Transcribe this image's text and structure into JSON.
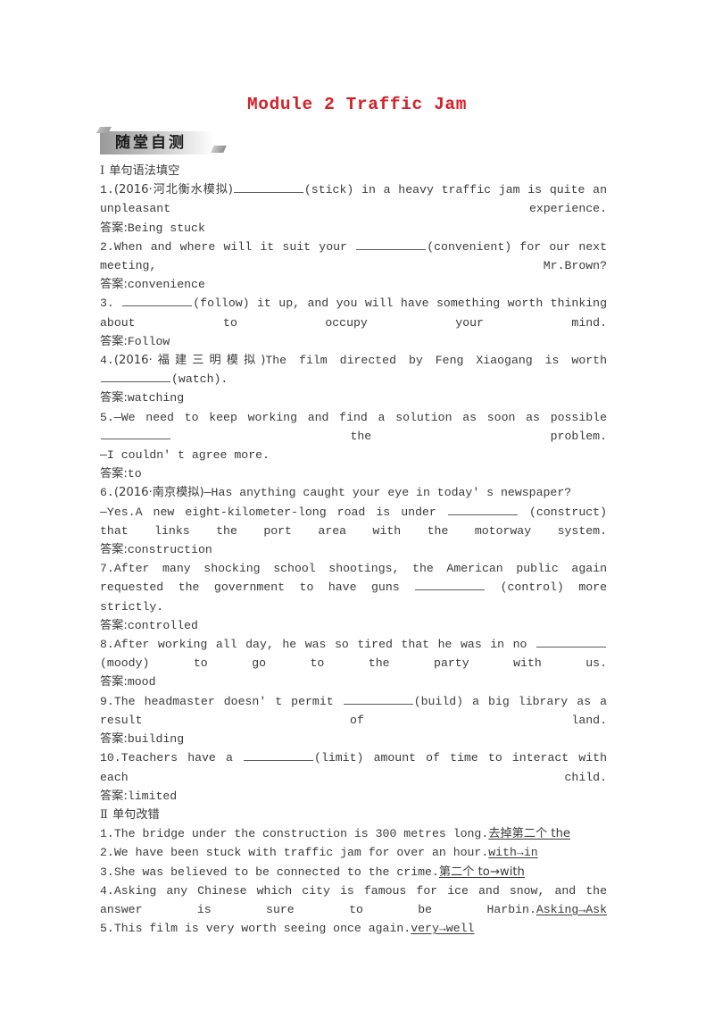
{
  "title": "Module 2 Traffic Jam",
  "accent_color": "#d81f26",
  "banner": {
    "label": "随堂自测"
  },
  "sections": [
    {
      "numeral": "Ⅰ",
      "heading": "单句语法填空",
      "answer_label": "答案:",
      "items": [
        {
          "number": "1.",
          "source": "(2016·河北衡水模拟)",
          "text_before": "",
          "cue": "(stick)",
          "text_after": " in a heavy traffic jam is quite an unpleasant experience.",
          "answer": "Being stuck"
        },
        {
          "number": "2.",
          "source": "",
          "text_before": "When and where will it suit your ",
          "cue": "(convenient)",
          "text_after": " for our next meeting, Mr.Brown?",
          "answer": "convenience"
        },
        {
          "number": "3.",
          "source": "",
          "text_before": " ",
          "cue": "(follow)",
          "text_after": " it up, and you will have something worth thinking about to occupy your mind.",
          "answer": "Follow"
        },
        {
          "number": "4.",
          "source": "(2016·福建三明模拟)",
          "text_before": "The film directed by Feng Xiaogang is worth ",
          "cue": "(watch).",
          "text_after": "",
          "answer": "watching"
        },
        {
          "number": "5.",
          "source": "",
          "text_before": "—We need to keep working and find a solution as soon as possible ",
          "cue": "",
          "text_after": " the problem.",
          "reply": "—I couldn' t agree more.",
          "answer": "to"
        },
        {
          "number": "6.",
          "source": "(2016·南京模拟)",
          "text_before": "—Has anything caught your eye in today' s newspaper?",
          "line2_before": "—Yes.A new eight-kilometer-long road is under ",
          "cue": "(construct)",
          "text_after": " that links the port area with the motorway system.",
          "answer": "construction"
        },
        {
          "number": "7.",
          "source": "",
          "text_before": "After many shocking school shootings, the American public again requested the government to have guns ",
          "cue": "(control)",
          "text_after": " more strictly.",
          "answer": "controlled"
        },
        {
          "number": "8.",
          "source": "",
          "text_before": "After working all day, he was so tired that he was in no ",
          "cue": "(moody)",
          "text_after": " to go to the party with us.",
          "answer": "mood"
        },
        {
          "number": "9.",
          "source": "",
          "text_before": "The headmaster doesn' t permit ",
          "cue": "(build)",
          "text_after": " a big library as a result of land.",
          "answer": "building"
        },
        {
          "number": "10.",
          "source": "",
          "text_before": "Teachers have a ",
          "cue": "(limit)",
          "text_after": " amount of time to interact with each child.",
          "answer": "limited"
        }
      ]
    },
    {
      "numeral": "Ⅱ",
      "heading": "单句改错",
      "items": [
        {
          "number": "1.",
          "sentence": "The bridge under the construction is 300 metres long.",
          "correction": "去掉第二个 the"
        },
        {
          "number": "2.",
          "sentence": "We have been stuck with traffic jam for over an hour.",
          "correction": "with→in"
        },
        {
          "number": "3.",
          "sentence": "She was believed to be connected to the crime.",
          "correction": "第二个 to→with"
        },
        {
          "number": "4.",
          "sentence": "Asking any Chinese which city is famous for ice and snow, and the answer is sure to be Harbin.",
          "correction": "Asking→Ask"
        },
        {
          "number": "5.",
          "sentence": "This film is very worth seeing once again.",
          "correction": "very→well"
        }
      ]
    }
  ]
}
